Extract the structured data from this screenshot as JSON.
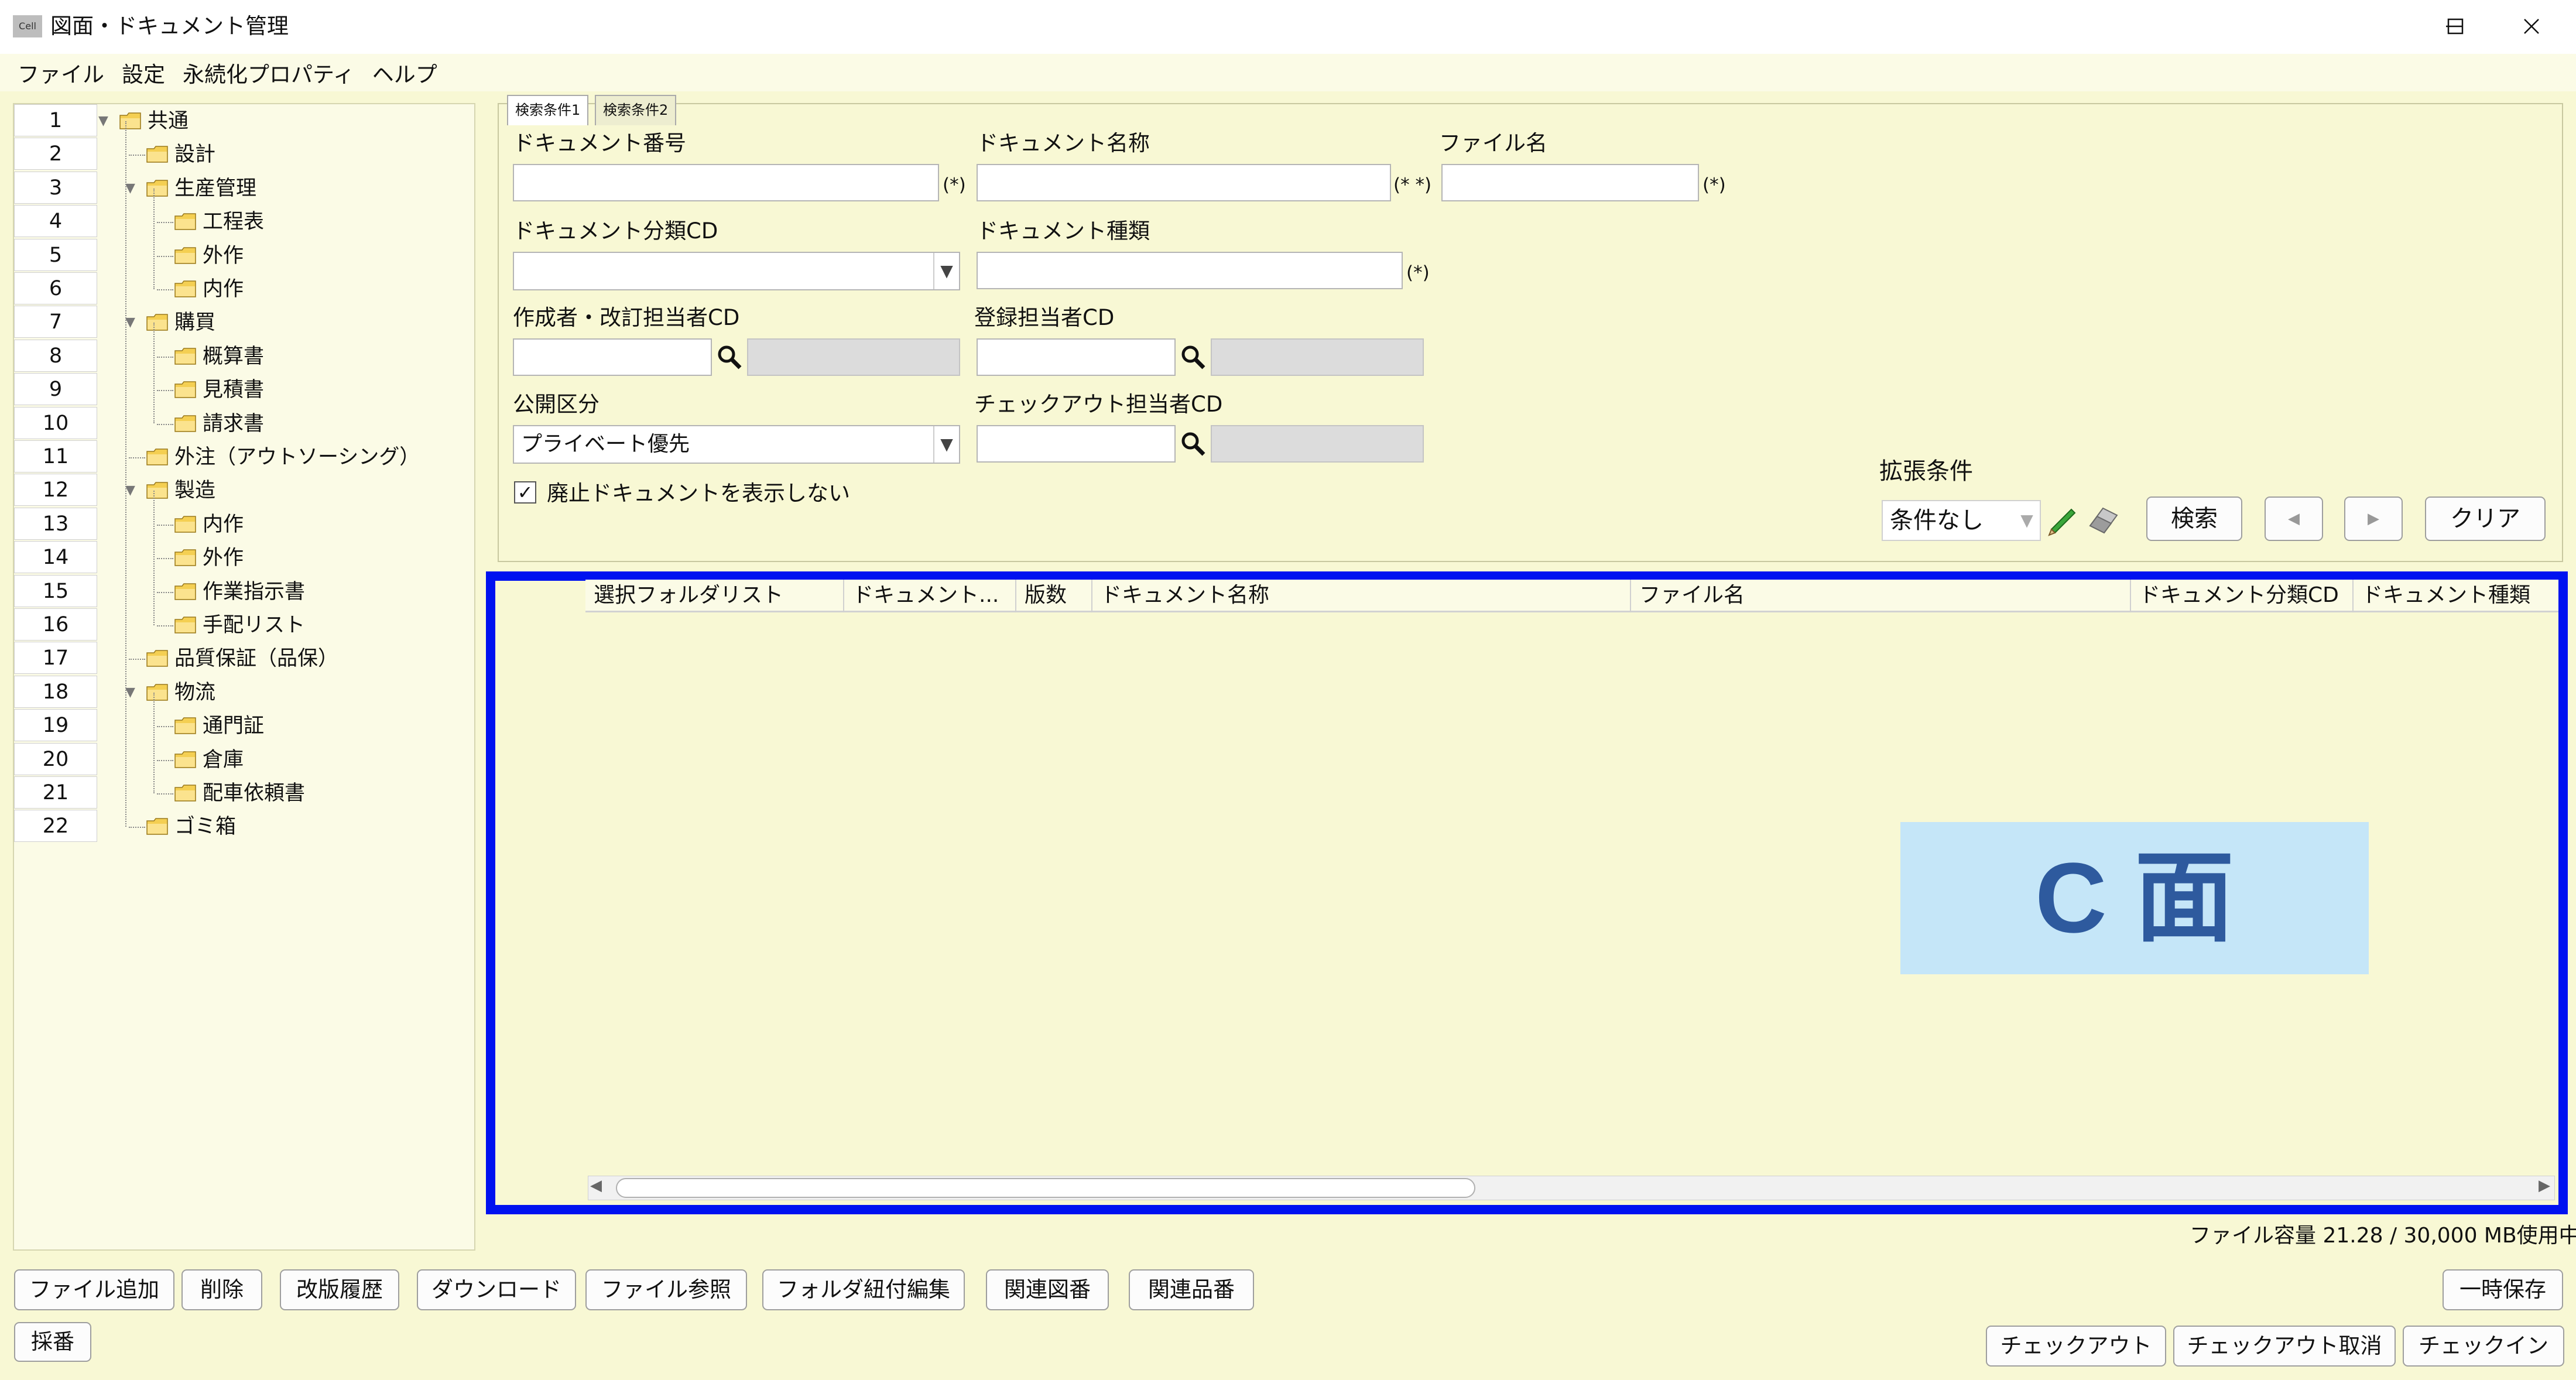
{
  "window": {
    "logo_text": "Cell",
    "title": "図面・ドキュメント管理"
  },
  "menu": [
    "ファイル",
    "設定",
    "永続化プロパティ",
    "ヘルプ"
  ],
  "tree": {
    "nums": [
      "1",
      "2",
      "3",
      "4",
      "5",
      "6",
      "7",
      "8",
      "9",
      "10",
      "11",
      "12",
      "13",
      "14",
      "15",
      "16",
      "17",
      "18",
      "19",
      "20",
      "21",
      "22"
    ],
    "labels": [
      "共通",
      "設計",
      "生産管理",
      "工程表",
      "外作",
      "内作",
      "購買",
      "概算書",
      "見積書",
      "請求書",
      "外注（アウトソーシング）",
      "製造",
      "内作",
      "外作",
      "作業指示書",
      "手配リスト",
      "品質保証（品保）",
      "物流",
      "通門証",
      "倉庫",
      "配車依頼書",
      "ゴミ箱"
    ]
  },
  "search": {
    "tabs": [
      "検索条件1",
      "検索条件2"
    ],
    "doc_number_label": "ドキュメント番号",
    "doc_name_label": "ドキュメント名称",
    "file_name_label": "ファイル名",
    "doc_class_label": "ドキュメント分類CD",
    "doc_type_label": "ドキュメント種類",
    "author_label": "作成者・改訂担当者CD",
    "registrar_label": "登録担当者CD",
    "public_label": "公開区分",
    "public_value": "プライベート優先",
    "checkout_label": "チェックアウト担当者CD",
    "hide_obsolete_label": "廃止ドキュメントを表示しない",
    "req1": "(*)",
    "req2": "(* *)",
    "req3": "(*)",
    "req4": "(*)",
    "ext_label": "拡張条件",
    "ext_value": "条件なし",
    "search_btn": "検索",
    "clear_btn": "クリア"
  },
  "grid": {
    "columns": [
      "選択フォルダリスト",
      "ドキュメント...",
      "版数",
      "ドキュメント名称",
      "ファイル名",
      "ドキュメント分類CD",
      "ドキュメント種類"
    ]
  },
  "overlay_label": "C 面",
  "capacity": "ファイル容量  21.28 / 30,000 MB使用中",
  "buttons": {
    "add_file": "ファイル追加",
    "delete": "削除",
    "history": "改版履歴",
    "download": "ダウンロード",
    "file_ref": "ファイル参照",
    "folder_link": "フォルダ紐付編集",
    "related_drawing": "関連図番",
    "related_part": "関連品番",
    "temp_save": "一時保存",
    "numbering": "採番",
    "checkout": "チェックアウト",
    "checkout_cancel": "チェックアウト取消",
    "checkin": "チェックイン"
  },
  "colors": {
    "background": "#f8f8d4",
    "highlight_border": "#0012f0",
    "overlay_bg": "#c5e6f8",
    "overlay_text": "#2e5a9e"
  }
}
